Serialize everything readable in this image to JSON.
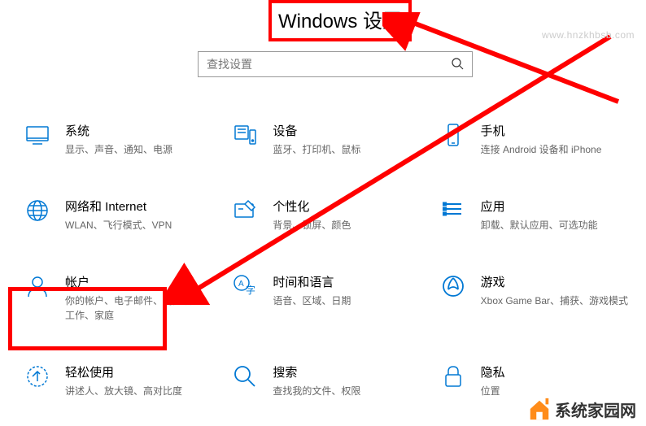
{
  "title": "Windows 设置",
  "search": {
    "placeholder": "查找设置"
  },
  "items": [
    {
      "title": "系统",
      "desc": "显示、声音、通知、电源"
    },
    {
      "title": "设备",
      "desc": "蓝牙、打印机、鼠标"
    },
    {
      "title": "手机",
      "desc": "连接 Android 设备和 iPhone"
    },
    {
      "title": "网络和 Internet",
      "desc": "WLAN、飞行模式、VPN"
    },
    {
      "title": "个性化",
      "desc": "背景、锁屏、颜色"
    },
    {
      "title": "应用",
      "desc": "卸载、默认应用、可选功能"
    },
    {
      "title": "帐户",
      "desc": "你的帐户、电子邮件、同步设置、工作、家庭"
    },
    {
      "title": "时间和语言",
      "desc": "语音、区域、日期"
    },
    {
      "title": "游戏",
      "desc": "Xbox Game Bar、捕获、游戏模式"
    },
    {
      "title": "轻松使用",
      "desc": "讲述人、放大镜、高对比度"
    },
    {
      "title": "搜索",
      "desc": "查找我的文件、权限"
    },
    {
      "title": "隐私",
      "desc": "位置"
    }
  ],
  "watermark_top": "www.hnzkhbsb.com",
  "watermark_bottom": "系统家园网"
}
